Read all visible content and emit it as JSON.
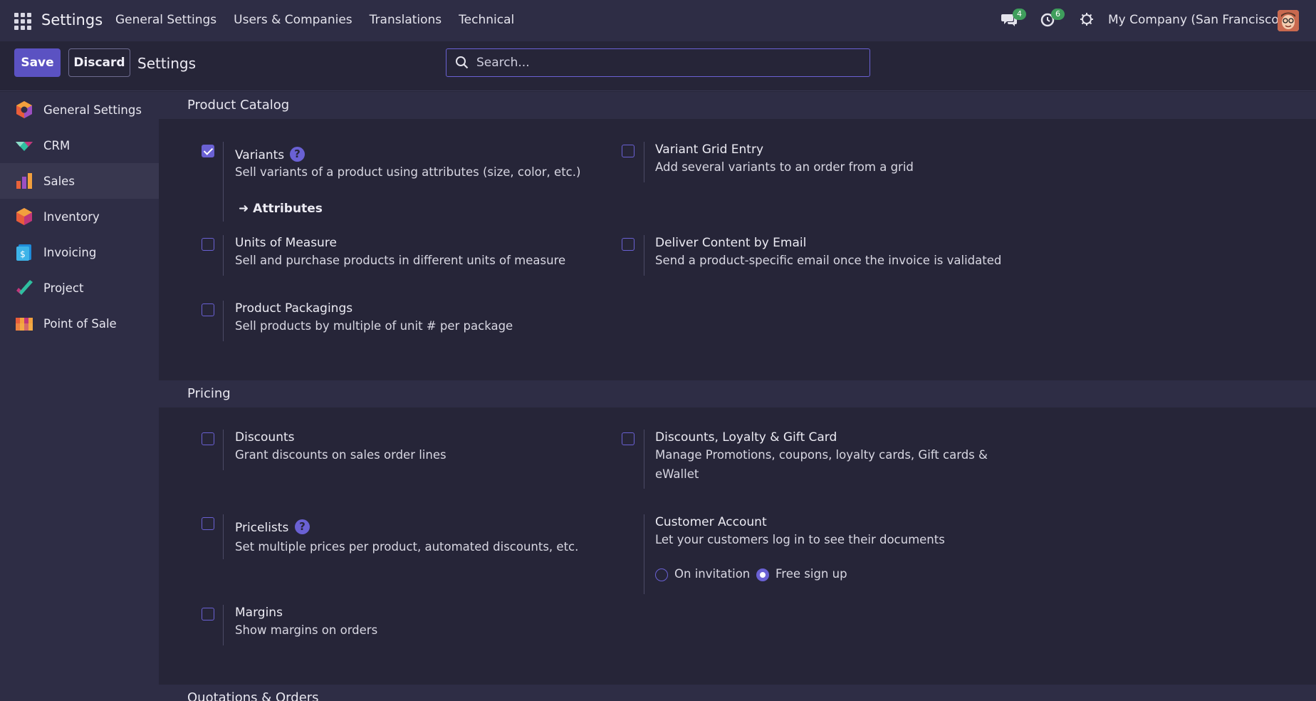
{
  "navbar": {
    "app_name": "Settings",
    "menu": [
      "General Settings",
      "Users & Companies",
      "Translations",
      "Technical"
    ],
    "messages_count": "4",
    "activities_count": "6",
    "company": "My Company (San Francisco)"
  },
  "control_panel": {
    "save_label": "Save",
    "discard_label": "Discard",
    "title": "Settings",
    "search_placeholder": "Search..."
  },
  "sidebar": {
    "items": [
      {
        "label": "General Settings",
        "icon": "general-settings-icon"
      },
      {
        "label": "CRM",
        "icon": "crm-icon"
      },
      {
        "label": "Sales",
        "icon": "sales-icon",
        "active": true
      },
      {
        "label": "Inventory",
        "icon": "inventory-icon"
      },
      {
        "label": "Invoicing",
        "icon": "invoicing-icon"
      },
      {
        "label": "Project",
        "icon": "project-icon"
      },
      {
        "label": "Point of Sale",
        "icon": "point-of-sale-icon"
      }
    ]
  },
  "sections": {
    "product_catalog": {
      "title": "Product Catalog",
      "variants": {
        "title": "Variants",
        "desc": "Sell variants of a product using attributes (size, color, etc.)",
        "checked": true,
        "link": "Attributes"
      },
      "variant_grid": {
        "title": "Variant Grid Entry",
        "desc": "Add several variants to an order from a grid",
        "checked": false
      },
      "uom": {
        "title": "Units of Measure",
        "desc": "Sell and purchase products in different units of measure",
        "checked": false
      },
      "deliver_email": {
        "title": "Deliver Content by Email",
        "desc": "Send a product-specific email once the invoice is validated",
        "checked": false
      },
      "packagings": {
        "title": "Product Packagings",
        "desc": "Sell products by multiple of unit # per package",
        "checked": false
      }
    },
    "pricing": {
      "title": "Pricing",
      "discounts": {
        "title": "Discounts",
        "desc": "Grant discounts on sales order lines",
        "checked": false
      },
      "loyalty": {
        "title": "Discounts, Loyalty & Gift Card",
        "desc": "Manage Promotions, coupons, loyalty cards, Gift cards & eWallet",
        "checked": false
      },
      "pricelists": {
        "title": "Pricelists",
        "desc": "Set multiple prices per product, automated discounts, etc.",
        "checked": false
      },
      "customer_account": {
        "title": "Customer Account",
        "desc": "Let your customers log in to see their documents",
        "options": [
          "On invitation",
          "Free sign up"
        ],
        "selected": "Free sign up"
      },
      "margins": {
        "title": "Margins",
        "desc": "Show margins on orders",
        "checked": false
      }
    },
    "quotations": {
      "title": "Quotations & Orders"
    }
  },
  "colors": {
    "accent": "#6a61d4",
    "save": "#5b52c2",
    "badge": "#3f9e5c"
  }
}
